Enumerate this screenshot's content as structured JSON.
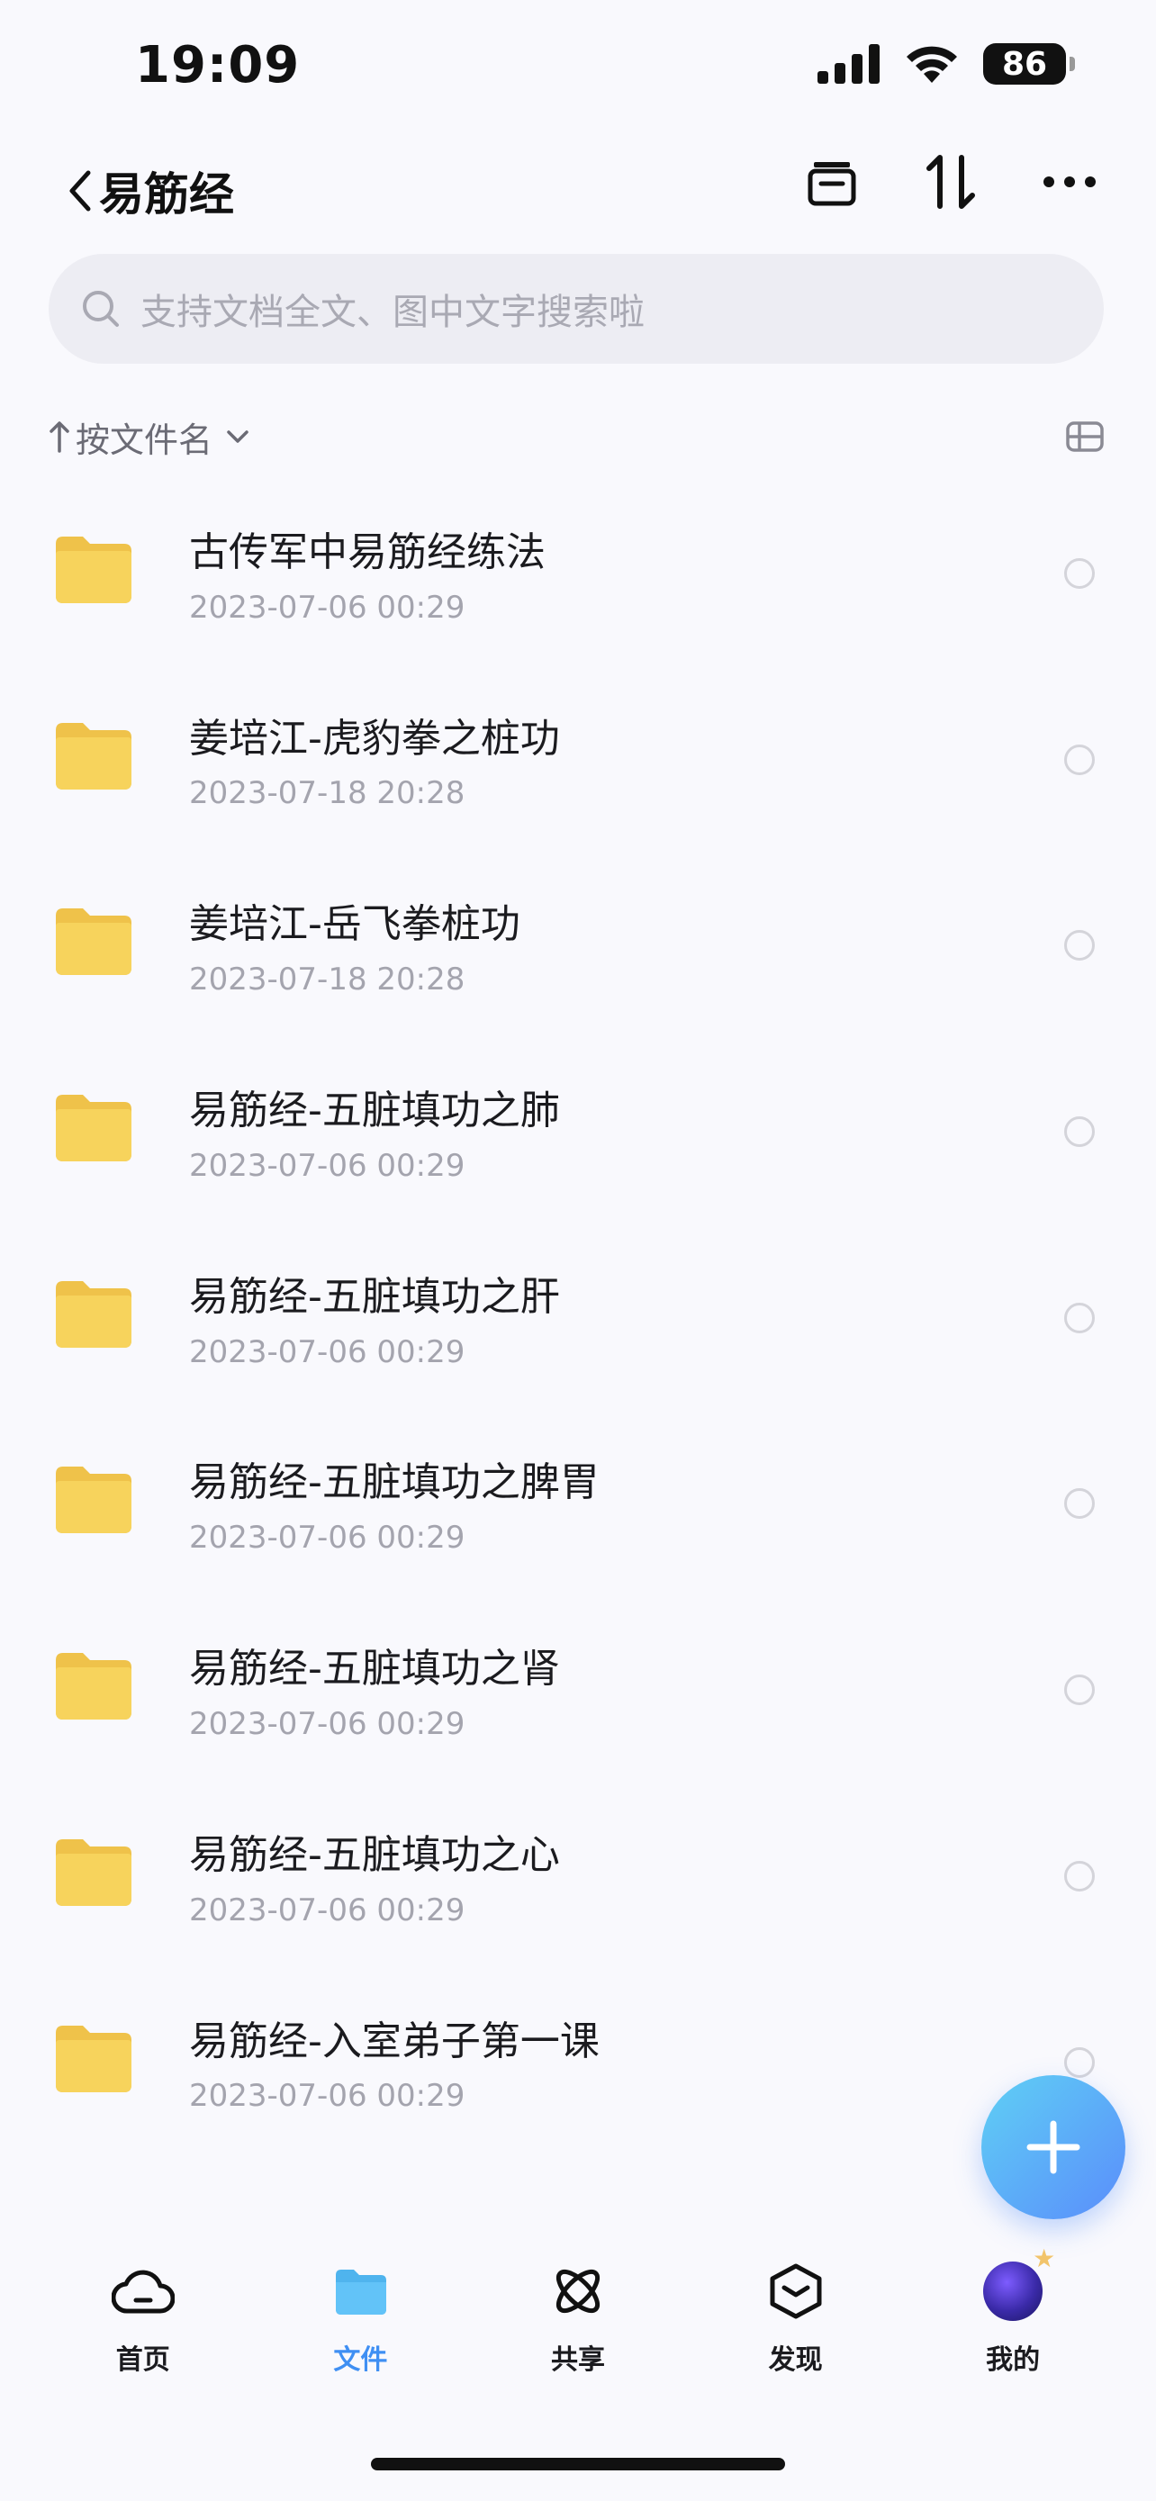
{
  "status_bar": {
    "time": "19:09",
    "battery": "86"
  },
  "header": {
    "back_label": "易筋经"
  },
  "search": {
    "placeholder": "支持文档全文、图中文字搜索啦"
  },
  "sort": {
    "label": "按文件名"
  },
  "files": [
    {
      "name": "古传军中易筋经练法",
      "date": "2023-07-06 00:29"
    },
    {
      "name": "姜培江-虎豹拳之桩功",
      "date": "2023-07-18 20:28"
    },
    {
      "name": "姜培江-岳飞拳桩功",
      "date": "2023-07-18 20:28"
    },
    {
      "name": "易筋经-五脏填功之肺",
      "date": "2023-07-06 00:29"
    },
    {
      "name": "易筋经-五脏填功之肝",
      "date": "2023-07-06 00:29"
    },
    {
      "name": "易筋经-五脏填功之脾胃",
      "date": "2023-07-06 00:29"
    },
    {
      "name": "易筋经-五脏填功之肾",
      "date": "2023-07-06 00:29"
    },
    {
      "name": "易筋经-五脏填功之心",
      "date": "2023-07-06 00:29"
    },
    {
      "name": "易筋经-入室弟子第一课",
      "date": "2023-07-06 00:29"
    }
  ],
  "tabs": [
    {
      "label": "首页",
      "icon": "cloud-icon",
      "active": false
    },
    {
      "label": "文件",
      "icon": "folder-icon",
      "active": true
    },
    {
      "label": "共享",
      "icon": "orbit-icon",
      "active": false
    },
    {
      "label": "发现",
      "icon": "cube-icon",
      "active": false
    },
    {
      "label": "我的",
      "icon": "avatar",
      "active": false
    }
  ],
  "colors": {
    "accent": "#3f8ff3",
    "folder": "#f7d35c",
    "fab_start": "#5fd0f5",
    "fab_end": "#5a8dfb"
  }
}
